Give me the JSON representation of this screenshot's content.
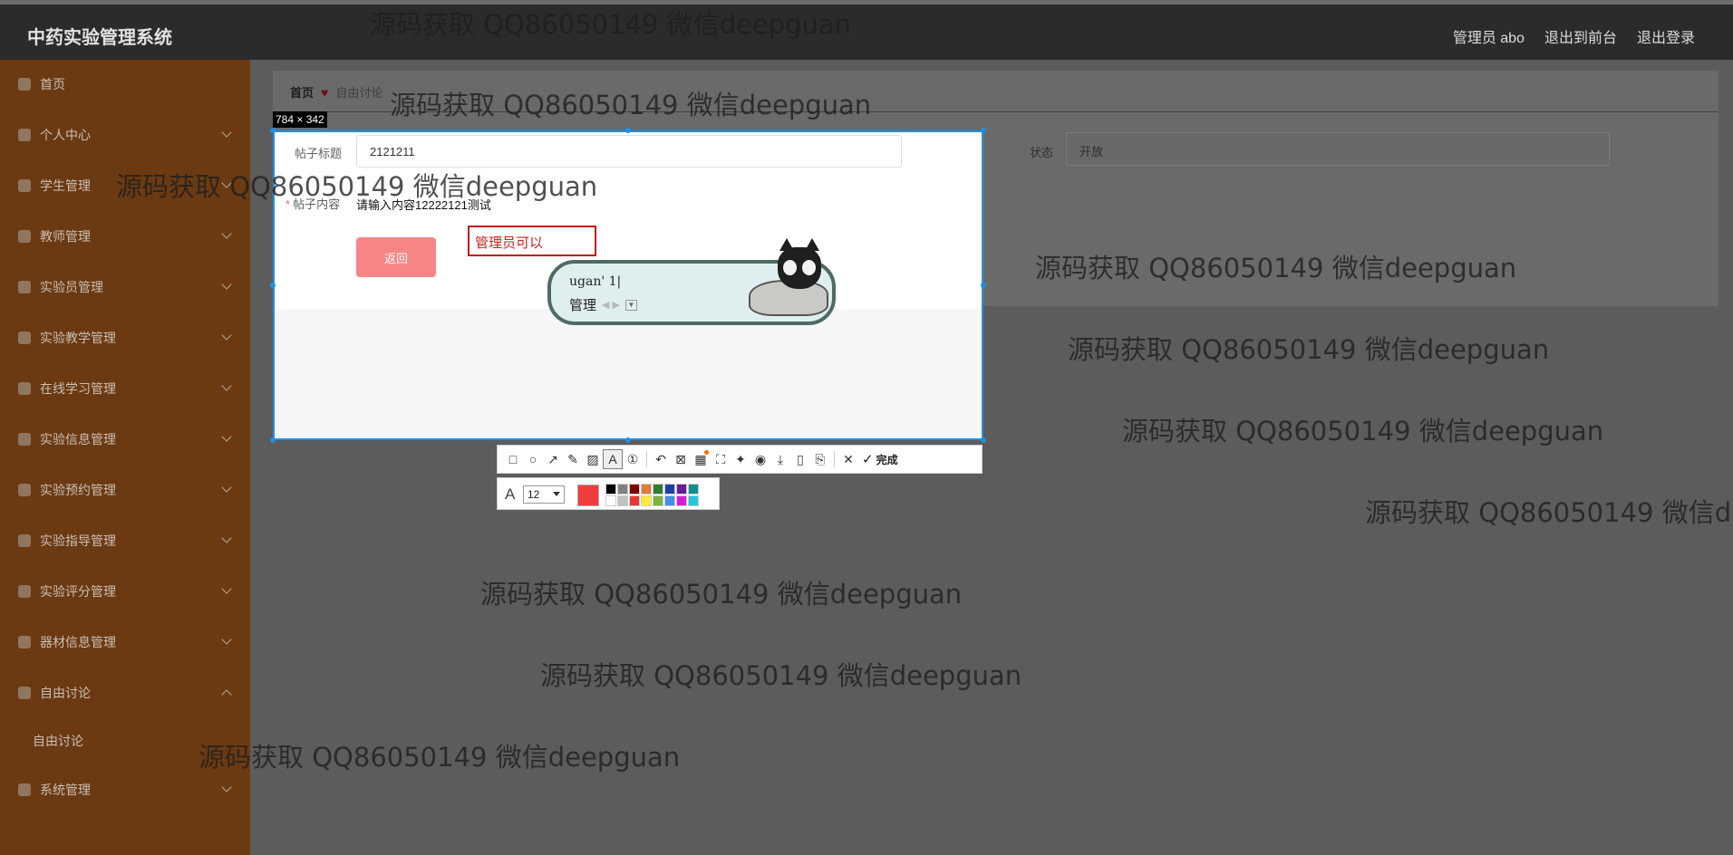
{
  "header": {
    "brand": "中药实验管理系统",
    "nav": [
      "管理员 abo",
      "退出到前台",
      "退出登录"
    ]
  },
  "sidebar": {
    "items": [
      {
        "label": "首页",
        "icon": "home-icon",
        "chevron": false
      },
      {
        "label": "个人中心",
        "icon": "user-icon",
        "chevron": true
      },
      {
        "label": "学生管理",
        "icon": "student-icon",
        "chevron": true
      },
      {
        "label": "教师管理",
        "icon": "list-icon",
        "chevron": true
      },
      {
        "label": "实验员管理",
        "icon": "folder-icon",
        "chevron": true
      },
      {
        "label": "实验教学管理",
        "icon": "book-icon",
        "chevron": true
      },
      {
        "label": "在线学习管理",
        "icon": "list-icon",
        "chevron": true
      },
      {
        "label": "实验信息管理",
        "icon": "info-icon",
        "chevron": true
      },
      {
        "label": "实验预约管理",
        "icon": "calendar-icon",
        "chevron": true
      },
      {
        "label": "实验指导管理",
        "icon": "guide-icon",
        "chevron": true
      },
      {
        "label": "实验评分管理",
        "icon": "score-icon",
        "chevron": true
      },
      {
        "label": "器材信息管理",
        "icon": "equipment-icon",
        "chevron": true
      },
      {
        "label": "自由讨论",
        "icon": "chat-icon",
        "chevron": true,
        "expanded": true
      },
      {
        "label": "系统管理",
        "icon": "settings-icon",
        "chevron": true
      }
    ],
    "sub_item": "自由讨论"
  },
  "breadcrumb": {
    "home": "首页",
    "current": "自由讨论"
  },
  "form": {
    "title_label": "帖子标题",
    "title_value": "2121211",
    "content_label": "帖子内容",
    "content_required_mark": "*",
    "content_value": "请输入内容12222121测试",
    "back_button": "返回",
    "status_label": "状态",
    "status_value": "开放"
  },
  "capture": {
    "size_label": "784 × 342",
    "text_annotation": "管理员可以"
  },
  "ime": {
    "composition": "ugan' 1|",
    "candidate": "管理"
  },
  "toolbar": {
    "tools": [
      "rectangle-icon",
      "ellipse-icon",
      "arrow-icon",
      "pen-icon",
      "mosaic-icon",
      "text-icon",
      "number-icon",
      "undo-icon",
      "long-screenshot-icon",
      "ocr-icon",
      "scan-icon",
      "pin-icon",
      "record-icon",
      "download-icon",
      "phone-icon",
      "bookmark-icon",
      "close-icon"
    ],
    "done_label": "完成"
  },
  "text_settings": {
    "font_size": "12",
    "current_color": "#f03c3c",
    "palette": [
      "#000000",
      "#808080",
      "#800000",
      "#e07b39",
      "#2e7d32",
      "#1f3fa8",
      "#6a1b9a",
      "#138d8d",
      "#ffffff",
      "#c0c0c0",
      "#e53935",
      "#ffeb3b",
      "#7cb342",
      "#3f8ee8",
      "#d81bd8",
      "#26c6da"
    ]
  },
  "watermark_text": "源码获取 QQ86050149 微信deepguan",
  "watermark_cut_text": "源码获取 QQ86050149 微信d"
}
